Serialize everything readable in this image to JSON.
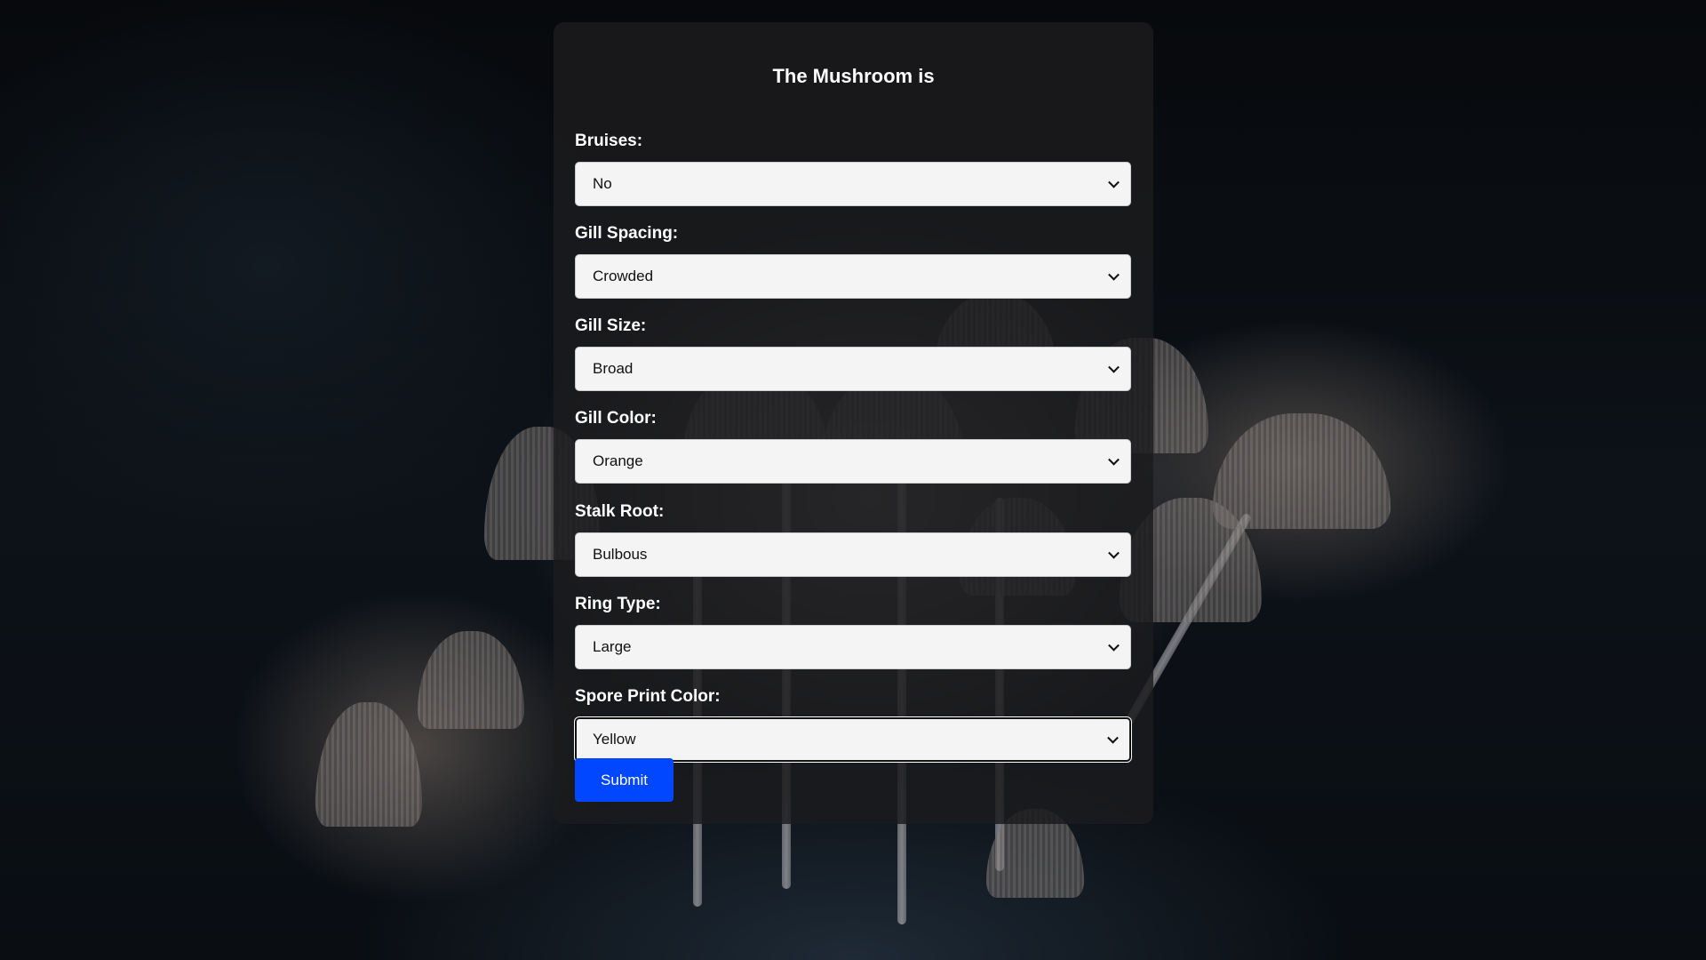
{
  "form": {
    "title": "The Mushroom is",
    "fields": [
      {
        "label": "Bruises:",
        "value": "No"
      },
      {
        "label": "Gill Spacing:",
        "value": "Crowded"
      },
      {
        "label": "Gill Size:",
        "value": "Broad"
      },
      {
        "label": "Gill Color:",
        "value": "Orange"
      },
      {
        "label": "Stalk Root:",
        "value": "Bulbous"
      },
      {
        "label": "Ring Type:",
        "value": "Large"
      },
      {
        "label": "Spore Print Color:",
        "value": "Yellow"
      }
    ],
    "submit_label": "Submit",
    "focused_field": "Spore Print Color:"
  },
  "colors": {
    "card_bg": "#1c1c1e",
    "submit_bg": "#0047ff",
    "select_bg": "#f4f4f4",
    "text": "#ffffff"
  }
}
